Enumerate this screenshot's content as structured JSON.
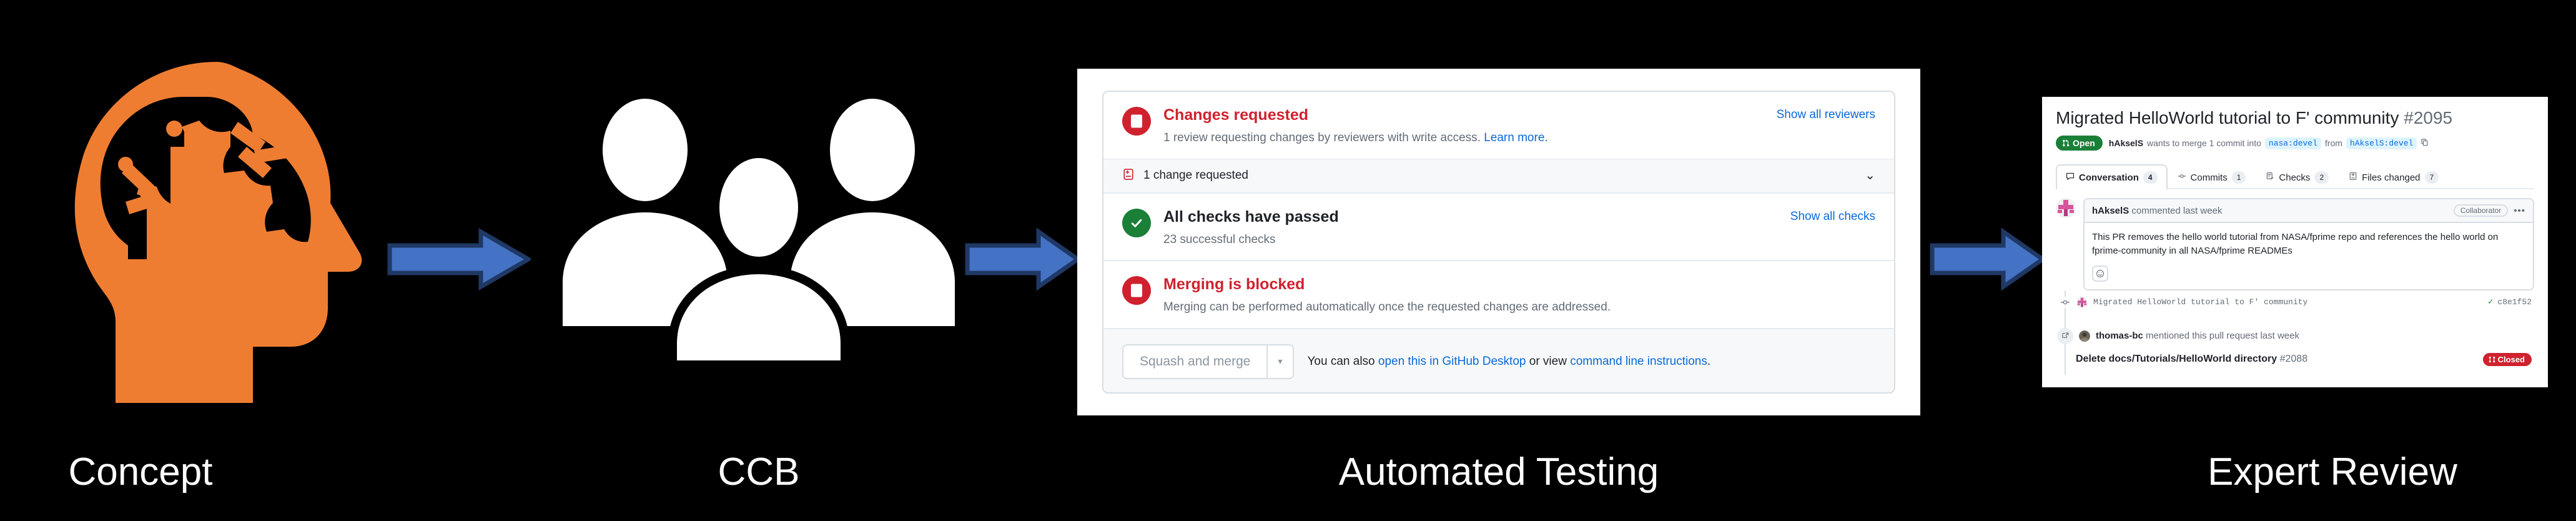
{
  "diagram": {
    "background_color": "#000000",
    "accent_orange": "#EE7D32",
    "arrow_fill": "#4472C4",
    "arrow_stroke": "#1F3864",
    "stages": [
      {
        "label": "Concept",
        "icon": "brain-head-icon"
      },
      {
        "label": "CCB",
        "icon": "people-group-icon"
      },
      {
        "label": "Automated Testing",
        "icon": "github-merge-box-screenshot"
      },
      {
        "label": "Expert Review",
        "icon": "github-pull-request-screenshot"
      }
    ]
  },
  "merge_box": {
    "changes_requested": {
      "title": "Changes requested",
      "subtitle": "1 review requesting changes by reviewers with write access.",
      "learn_more": "Learn more.",
      "action": "Show all reviewers",
      "badge_color": "#cf222e"
    },
    "collapsed_row": {
      "text": "1 change requested",
      "chevron": "⌄"
    },
    "checks": {
      "title": "All checks have passed",
      "subtitle": "23 successful checks",
      "action": "Show all checks",
      "badge_color": "#1a7f37"
    },
    "merging": {
      "title": "Merging is blocked",
      "subtitle": "Merging can be performed automatically once the requested changes are addressed.",
      "badge_color": "#cf222e"
    },
    "footer": {
      "merge_button": "Squash and merge",
      "caret": "▾",
      "note_prefix": "You can also ",
      "link_desktop": "open this in GitHub Desktop",
      "note_middle": " or view ",
      "link_cli": "command line instructions",
      "note_suffix": "."
    }
  },
  "pull_request": {
    "title": "Migrated HelloWorld tutorial to F' community",
    "number": "#2095",
    "state_badge": "Open",
    "meta_author": "hAkselS",
    "meta_text_1": "wants to merge 1 commit into",
    "base_branch": "nasa:devel",
    "meta_text_2": "from",
    "head_branch": "hAkselS:devel",
    "tabs": [
      {
        "label": "Conversation",
        "count": "4",
        "icon": "comment-icon",
        "active": true
      },
      {
        "label": "Commits",
        "count": "1",
        "icon": "commit-icon",
        "active": false
      },
      {
        "label": "Checks",
        "count": "2",
        "icon": "checklist-icon",
        "active": false
      },
      {
        "label": "Files changed",
        "count": "7",
        "icon": "diff-icon",
        "active": false
      }
    ],
    "comment": {
      "author": "hAkselS",
      "action": "commented last week",
      "role_chip": "Collaborator",
      "kebab": "•••",
      "body": "This PR removes the hello world tutorial from NASA/fprime repo and references the hello world on fprime-community in all NASA/fprime READMEs",
      "reaction_icon": "smiley-icon"
    },
    "timeline": {
      "commit_message": "Migrated HelloWorld tutorial to F' community",
      "commit_status": "✓",
      "commit_sha": "c8e1f52",
      "mention_author": "thomas-bc",
      "mention_action": "mentioned this pull request last week",
      "referenced_title": "Delete docs/Tutorials/HelloWorld directory",
      "referenced_number": "#2088",
      "referenced_state": "Closed"
    }
  }
}
